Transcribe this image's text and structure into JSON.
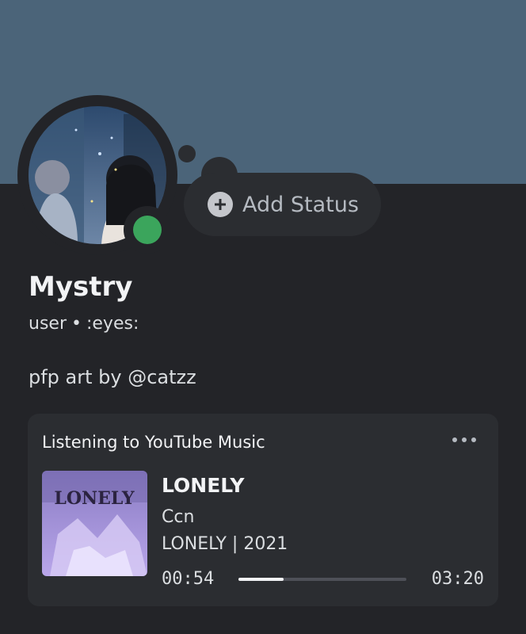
{
  "profile": {
    "username": "Mystry",
    "subtitle_left": "user",
    "subtitle_separator": "•",
    "subtitle_right": ":eyes:",
    "bio": "pfp art by @catzz",
    "online_status_color": "#3ba55c",
    "banner_color": "#4b6479"
  },
  "status_button": {
    "label": "Add Status",
    "icon": "plus-circle-icon"
  },
  "activity": {
    "header": "Listening to YouTube Music",
    "menu_icon": "more-horizontal-icon",
    "track_title": "LONELY",
    "artist": "Ccn",
    "album_line": "LONELY | 2021",
    "time_elapsed": "00:54",
    "time_total": "03:20",
    "progress_fraction": 0.27,
    "album_art_text": "LONELY"
  }
}
